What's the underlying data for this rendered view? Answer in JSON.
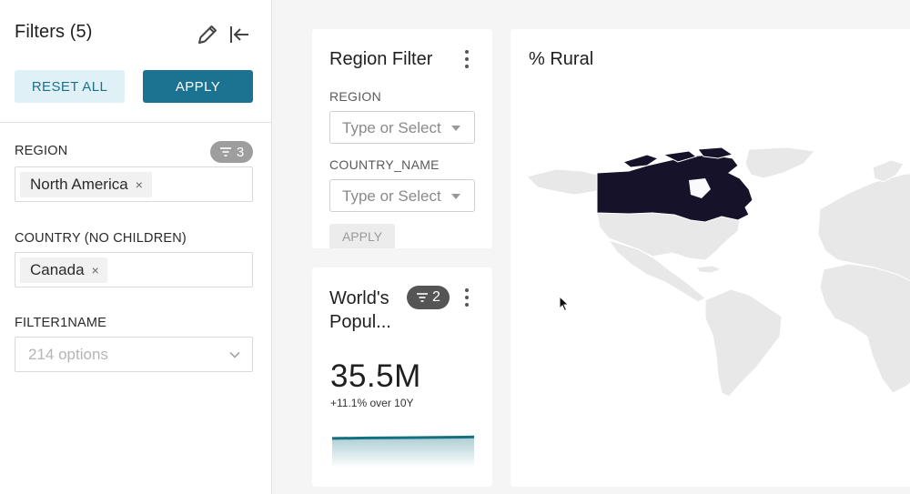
{
  "sidebar": {
    "title": "Filters (5)",
    "reset_label": "RESET ALL",
    "apply_label": "APPLY",
    "filters": [
      {
        "label": "REGION",
        "badge_count": "3",
        "chip": "North America"
      },
      {
        "label": "COUNTRY (NO CHILDREN)",
        "chip": "Canada"
      },
      {
        "label": "FILTER1NAME",
        "placeholder": "214 options"
      }
    ],
    "chip_remove": "×"
  },
  "region_filter_card": {
    "title": "Region Filter",
    "fields": [
      {
        "label": "REGION",
        "placeholder": "Type or Select"
      },
      {
        "label": "COUNTRY_NAME",
        "placeholder": "Type or Select"
      }
    ],
    "apply_label": "APPLY"
  },
  "kpi_card": {
    "title_line1": "World's",
    "title_line2": "Popul...",
    "filter_badge_count": "2",
    "value": "35.5M",
    "change": "+11.1% over 10Y",
    "trend": [
      35.2,
      35.3,
      35.35,
      35.4,
      35.5
    ]
  },
  "map_card": {
    "title": "% Rural",
    "highlighted_country": "Canada"
  },
  "icons": [
    "edit-pencil-icon",
    "collapse-left-icon",
    "filter-icon",
    "chevron-down-icon",
    "kebab-menu-icon",
    "mouse-cursor-icon"
  ],
  "colors": {
    "accent": "#1c7391",
    "accent_light": "#dff1f6",
    "map_land": "#e8e8e8",
    "map_highlight": "#15122a",
    "trend_line": "#13707f"
  }
}
